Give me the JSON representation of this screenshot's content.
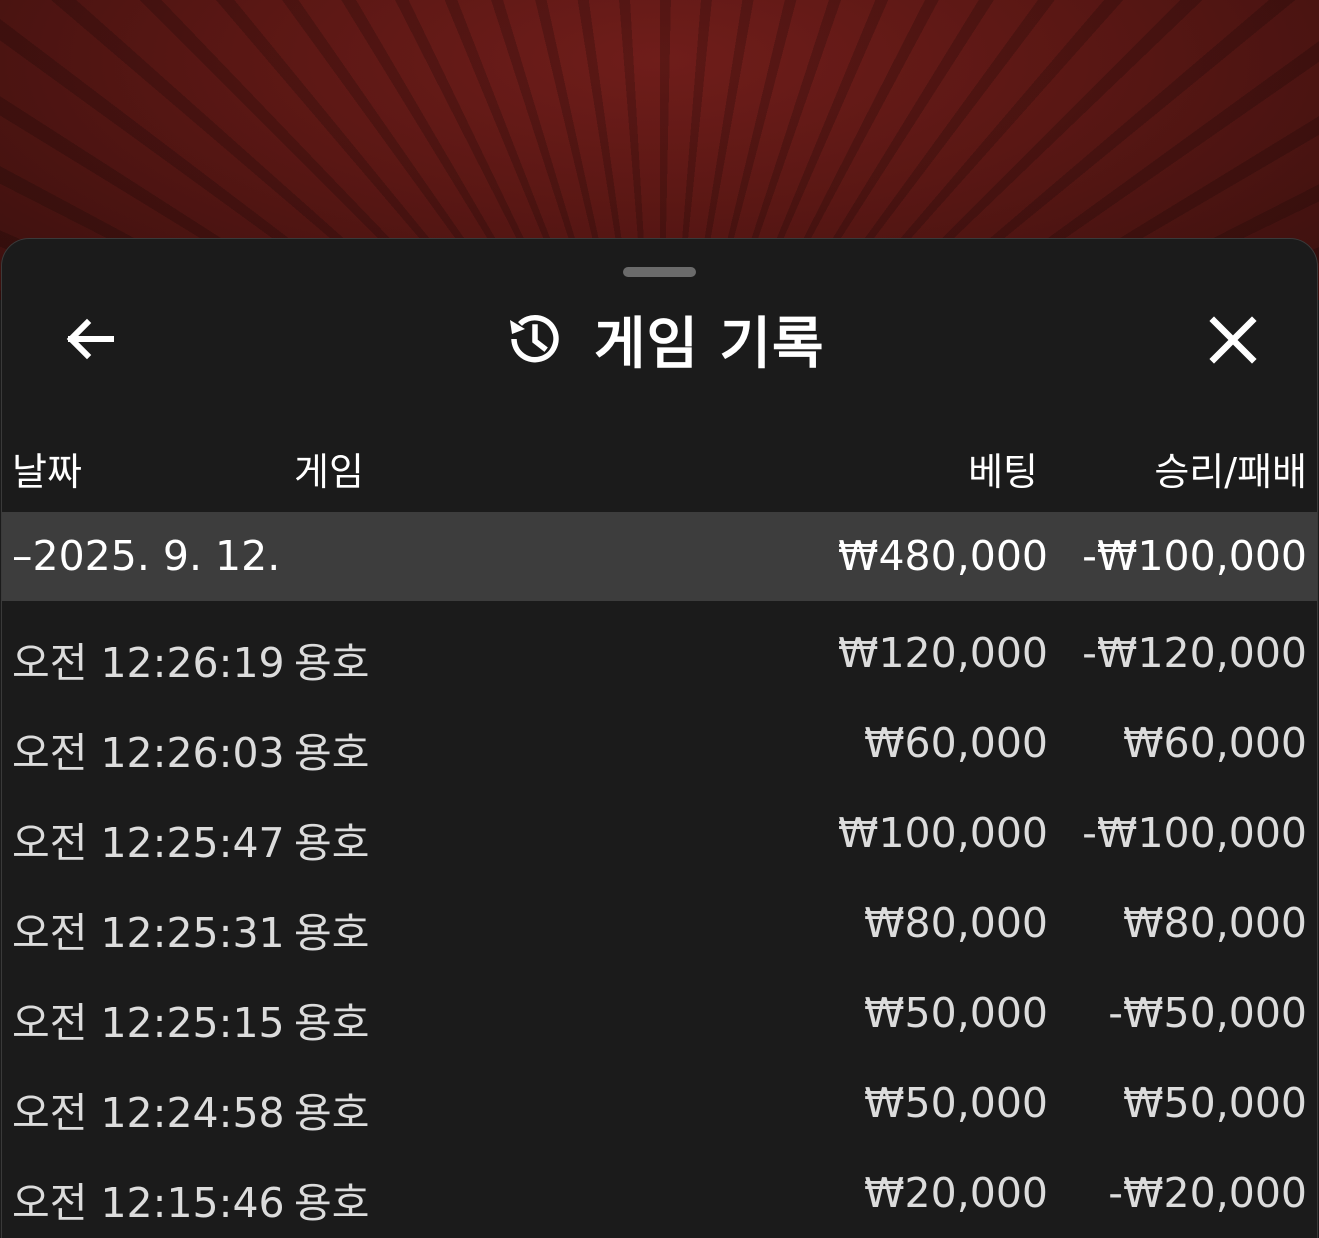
{
  "header": {
    "title": "게임 기록",
    "back_icon": "arrow-left-icon",
    "history_icon": "history-icon",
    "close_icon": "close-icon"
  },
  "table": {
    "columns": {
      "date": "날짜",
      "game": "게임",
      "bet": "베팅",
      "result": "승리/패배"
    },
    "group": {
      "date": "–2025. 9. 12.",
      "bet": "₩480,000",
      "result": "-₩100,000"
    },
    "rows": [
      {
        "time": "오전 12:26:19",
        "game": "용호",
        "bet": "₩120,000",
        "result": "-₩120,000"
      },
      {
        "time": "오전 12:26:03",
        "game": "용호",
        "bet": "₩60,000",
        "result": "₩60,000"
      },
      {
        "time": "오전 12:25:47",
        "game": "용호",
        "bet": "₩100,000",
        "result": "-₩100,000"
      },
      {
        "time": "오전 12:25:31",
        "game": "용호",
        "bet": "₩80,000",
        "result": "₩80,000"
      },
      {
        "time": "오전 12:25:15",
        "game": "용호",
        "bet": "₩50,000",
        "result": "-₩50,000"
      },
      {
        "time": "오전 12:24:58",
        "game": "용호",
        "bet": "₩50,000",
        "result": "₩50,000"
      },
      {
        "time": "오전 12:15:46",
        "game": "용호",
        "bet": "₩20,000",
        "result": "-₩20,000"
      }
    ]
  }
}
